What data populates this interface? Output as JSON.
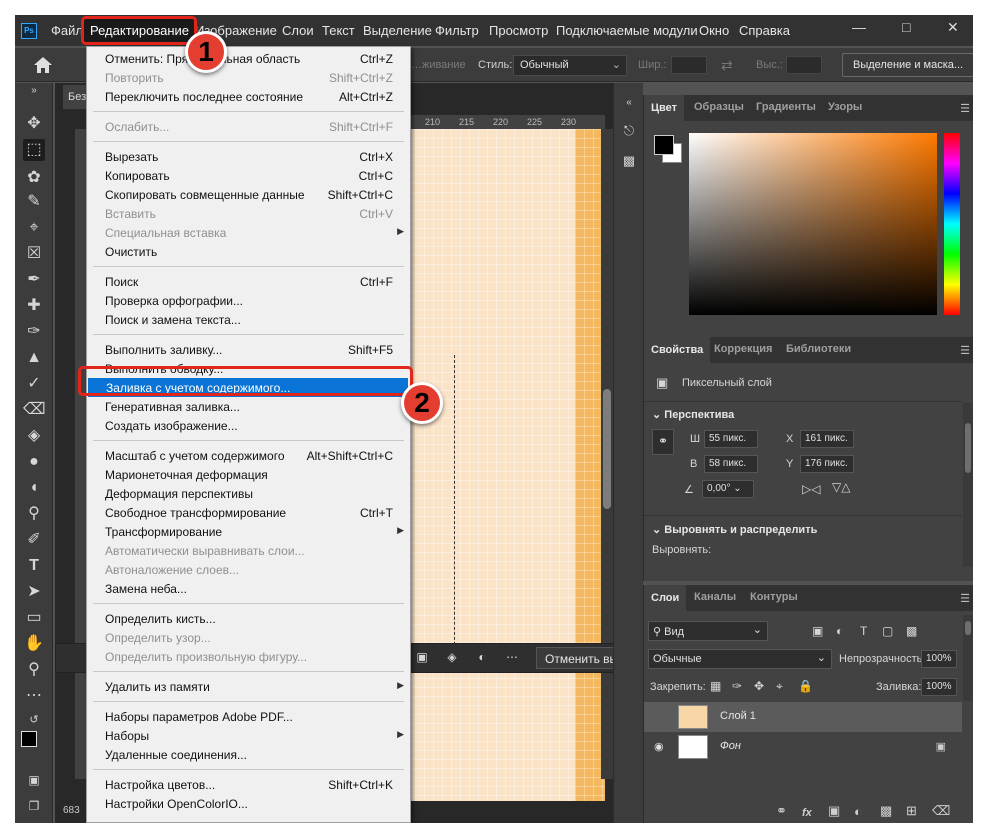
{
  "menubar": {
    "items": [
      "Файл",
      "Редактирование",
      "Изображение",
      "Слои",
      "Текст",
      "Выделение",
      "Фильтр",
      "Просмотр",
      "Подключаемые модули",
      "Окно",
      "Справка"
    ],
    "active_index": 1
  },
  "options_bar": {
    "style_label": "Стиль:",
    "style_value": "Обычный",
    "width_label": "Шир.:",
    "height_label": "Выс.:",
    "mask_button": "Выделение и маска...",
    "dim_label": "…живание"
  },
  "document": {
    "tab_label": "Без",
    "ruler_labels": [
      "210",
      "215",
      "220",
      "225",
      "230"
    ],
    "status": "683",
    "context_bar": {
      "deselect_button": "Отменить выделение"
    }
  },
  "edit_menu": {
    "items": [
      {
        "label": "Отменить: Прямоугольная область",
        "shortcut": "Ctrl+Z",
        "disabled": false
      },
      {
        "label": "Повторить",
        "shortcut": "Shift+Ctrl+Z",
        "disabled": true
      },
      {
        "label": "Переключить последнее состояние",
        "shortcut": "Alt+Ctrl+Z",
        "disabled": false
      },
      {
        "sep": true
      },
      {
        "label": "Ослабить...",
        "shortcut": "Shift+Ctrl+F",
        "disabled": true
      },
      {
        "sep": true
      },
      {
        "label": "Вырезать",
        "shortcut": "Ctrl+X",
        "disabled": false
      },
      {
        "label": "Копировать",
        "shortcut": "Ctrl+C",
        "disabled": false
      },
      {
        "label": "Скопировать совмещенные данные",
        "shortcut": "Shift+Ctrl+C",
        "disabled": false
      },
      {
        "label": "Вставить",
        "shortcut": "Ctrl+V",
        "disabled": true
      },
      {
        "label": "Специальная вставка",
        "shortcut": "",
        "disabled": true,
        "submenu": true
      },
      {
        "label": "Очистить",
        "shortcut": "",
        "disabled": false
      },
      {
        "sep": true
      },
      {
        "label": "Поиск",
        "shortcut": "Ctrl+F",
        "disabled": false
      },
      {
        "label": "Проверка орфографии...",
        "shortcut": "",
        "disabled": false
      },
      {
        "label": "Поиск и замена текста...",
        "shortcut": "",
        "disabled": false
      },
      {
        "sep": true
      },
      {
        "label": "Выполнить заливку...",
        "shortcut": "Shift+F5",
        "disabled": false
      },
      {
        "label": "Выполнить обводку...",
        "shortcut": "",
        "disabled": false
      },
      {
        "label": "Заливка с учетом содержимого...",
        "shortcut": "",
        "disabled": false,
        "highlight": true
      },
      {
        "label": "Генеративная заливка...",
        "shortcut": "",
        "disabled": false
      },
      {
        "label": "Создать изображение...",
        "shortcut": "",
        "disabled": false
      },
      {
        "sep": true
      },
      {
        "label": "Масштаб с учетом содержимого",
        "shortcut": "Alt+Shift+Ctrl+C",
        "disabled": false
      },
      {
        "label": "Марионеточная деформация",
        "shortcut": "",
        "disabled": false
      },
      {
        "label": "Деформация перспективы",
        "shortcut": "",
        "disabled": false
      },
      {
        "label": "Свободное трансформирование",
        "shortcut": "Ctrl+T",
        "disabled": false
      },
      {
        "label": "Трансформирование",
        "shortcut": "",
        "disabled": false,
        "submenu": true
      },
      {
        "label": "Автоматически выравнивать слои...",
        "shortcut": "",
        "disabled": true
      },
      {
        "label": "Автоналожение слоев...",
        "shortcut": "",
        "disabled": true
      },
      {
        "label": "Замена неба...",
        "shortcut": "",
        "disabled": false
      },
      {
        "sep": true
      },
      {
        "label": "Определить кисть...",
        "shortcut": "",
        "disabled": false
      },
      {
        "label": "Определить узор...",
        "shortcut": "",
        "disabled": true
      },
      {
        "label": "Определить произвольную фигуру...",
        "shortcut": "",
        "disabled": true
      },
      {
        "sep": true
      },
      {
        "label": "Удалить из памяти",
        "shortcut": "",
        "disabled": false,
        "submenu": true
      },
      {
        "sep": true
      },
      {
        "label": "Наборы параметров Adobe PDF...",
        "shortcut": "",
        "disabled": false
      },
      {
        "label": "Наборы",
        "shortcut": "",
        "disabled": false,
        "submenu": true
      },
      {
        "label": "Удаленные соединения...",
        "shortcut": "",
        "disabled": false
      },
      {
        "sep": true
      },
      {
        "label": "Настройка цветов...",
        "shortcut": "Shift+Ctrl+K",
        "disabled": false
      },
      {
        "label": "Настройки OpenColorIO...",
        "shortcut": "",
        "disabled": false
      }
    ]
  },
  "badges": [
    "1",
    "2"
  ],
  "color_panel": {
    "tabs": [
      "Цвет",
      "Образцы",
      "Градиенты",
      "Узоры"
    ]
  },
  "properties_panel": {
    "tabs": [
      "Свойства",
      "Коррекция",
      "Библиотеки"
    ],
    "layer_type": "Пиксельный слой",
    "perspective_header": "Перспектива",
    "w_label": "Ш",
    "w_value": "55 пикс.",
    "h_label": "В",
    "h_value": "58 пикс.",
    "x_label": "X",
    "x_value": "161 пикс.",
    "y_label": "Y",
    "y_value": "176 пикс.",
    "angle_value": "0,00°",
    "align_header": "Выровнять и распределить",
    "align_label": "Выровнять:"
  },
  "layers_panel": {
    "tabs": [
      "Слои",
      "Каналы",
      "Контуры"
    ],
    "filter_label": "Вид",
    "blend_mode": "Обычные",
    "opacity_label": "Непрозрачность:",
    "opacity_value": "100%",
    "lock_label": "Закрепить:",
    "fill_label": "Заливка:",
    "fill_value": "100%",
    "layers": [
      {
        "name": "Слой 1",
        "selected": true
      },
      {
        "name": "Фон",
        "selected": false,
        "locked": true
      }
    ]
  },
  "colors": {
    "highlight": "#0a74d6",
    "ring": "#e1251b",
    "badge": "#e33e2f"
  }
}
